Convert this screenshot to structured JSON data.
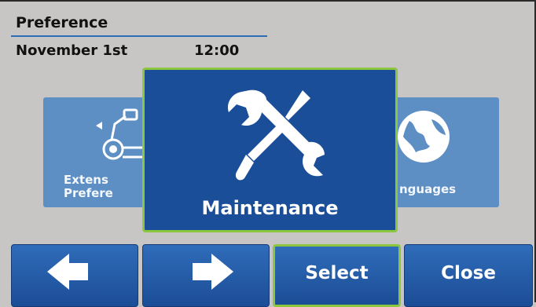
{
  "header": {
    "title": "Preference",
    "date": "November 1st",
    "time": "12:00"
  },
  "tiles": {
    "left": {
      "label_line1": "Extens",
      "label_line2": "Prefere",
      "icon": "extension-robot-icon"
    },
    "main": {
      "label": "Maintenance",
      "icon": "wrench-screwdriver-icon"
    },
    "right": {
      "label": "nguages",
      "icon": "globe-icon"
    }
  },
  "buttons": {
    "prev": {
      "icon": "arrow-left-icon"
    },
    "next": {
      "icon": "arrow-right-icon"
    },
    "select": "Select",
    "close": "Close"
  },
  "colors": {
    "accent_green": "#8cc63f",
    "tile_blue": "#1a4e98",
    "tile_light_blue": "#5d8fc4",
    "header_line": "#2d6db5"
  }
}
